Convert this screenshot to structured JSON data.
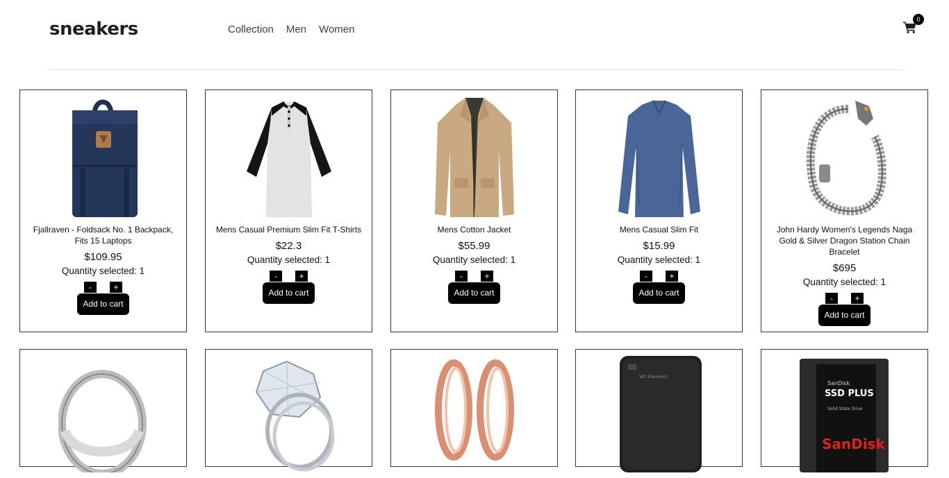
{
  "header": {
    "logo": "sneakers",
    "nav": [
      "Collection",
      "Men",
      "Women"
    ],
    "cart_count": "0"
  },
  "products": [
    {
      "title": "Fjallraven - Foldsack No. 1 Backpack, Fits 15 Laptops",
      "price": "$109.95",
      "quantity_label": "Quantity selected: 1",
      "minus": "-",
      "plus": "+",
      "add_label": "Add to cart",
      "image": "backpack"
    },
    {
      "title": "Mens Casual Premium Slim Fit T-Shirts",
      "price": "$22.3",
      "quantity_label": "Quantity selected: 1",
      "minus": "-",
      "plus": "+",
      "add_label": "Add to cart",
      "image": "raglan-tshirt"
    },
    {
      "title": "Mens Cotton Jacket",
      "price": "$55.99",
      "quantity_label": "Quantity selected: 1",
      "minus": "-",
      "plus": "+",
      "add_label": "Add to cart",
      "image": "jacket"
    },
    {
      "title": "Mens Casual Slim Fit",
      "price": "$15.99",
      "quantity_label": "Quantity selected: 1",
      "minus": "-",
      "plus": "+",
      "add_label": "Add to cart",
      "image": "longsleeve-shirt"
    },
    {
      "title": "John Hardy Women's Legends Naga Gold & Silver Dragon Station Chain Bracelet",
      "price": "$695",
      "quantity_label": "Quantity selected: 1",
      "minus": "-",
      "plus": "+",
      "add_label": "Add to cart",
      "image": "dragon-bracelet"
    }
  ],
  "products_row2": [
    {
      "image": "silver-ring"
    },
    {
      "image": "diamond-ring"
    },
    {
      "image": "rose-gold-rings"
    },
    {
      "image": "hard-drive",
      "print_text": "WD Elements"
    },
    {
      "image": "ssd",
      "print_text": [
        "SanDisk",
        "SSD PLUS",
        "Solid State Drive",
        "SanDisk"
      ]
    }
  ],
  "colors": {
    "accent": "#000000",
    "border": "#333333",
    "divider": "#e5e5e5",
    "text": "#1d2026"
  }
}
